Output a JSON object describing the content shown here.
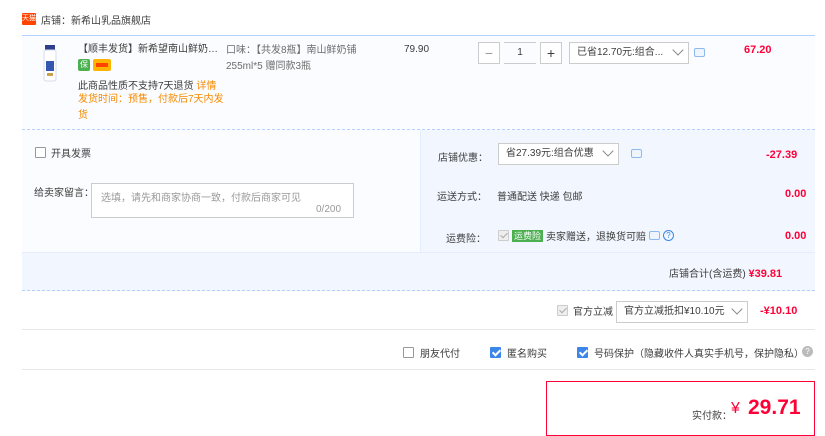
{
  "shop": {
    "badge": "天猫",
    "name": "店铺：新希山乳品旗舰店"
  },
  "item": {
    "title": "【顺丰发货】新希望南山鲜奶铺...",
    "service_icon_1": "保",
    "no_return": "此商品性质不支持7天退货",
    "detail_link": "详情",
    "ship_time": "发货时间：预售，付款后7天内发货",
    "sku": "口味：【共发8瓶】南山鲜奶铺255ml*5 赠同款3瓶",
    "price": "79.90",
    "qty_minus": "−",
    "qty": "1",
    "qty_plus": "+",
    "discount_select": "已省12.70元:组合...",
    "subtotal": "67.20"
  },
  "invoice_label": "开具发票",
  "message": {
    "label": "给卖家留言：",
    "placeholder": "选填，请先和商家协商一致，付款后商家可见",
    "count": "0/200"
  },
  "store_discount": {
    "label": "店铺优惠：",
    "select": "省27.39元:组合优惠",
    "value": "-27.39"
  },
  "shipping": {
    "label": "运送方式：",
    "method": "普通配送 快递 包邮",
    "value": "0.00"
  },
  "insurance": {
    "label": "运费险：",
    "tag": "运费险",
    "text": "卖家赠送，退换货可赔",
    "help": "?",
    "value": "0.00"
  },
  "store_total": {
    "label": "店铺合计(含运费)",
    "amount": "¥39.81"
  },
  "official": {
    "label": "官方立减",
    "select": "官方立减抵扣¥10.10元",
    "value": "-¥10.10"
  },
  "options": {
    "friend_pay": "朋友代付",
    "anonymous": "匿名购买",
    "number_protect": "号码保护（隐藏收件人真实手机号，保护隐私）",
    "help": "?"
  },
  "pay": {
    "label": "实付款：",
    "yen": "¥",
    "amount": "29.71"
  },
  "colors": {
    "price_red": "#ff0036",
    "accent_blue": "#3b86e8",
    "warning_orange": "#f58a00",
    "panel_bg": "#f2f7ff"
  }
}
